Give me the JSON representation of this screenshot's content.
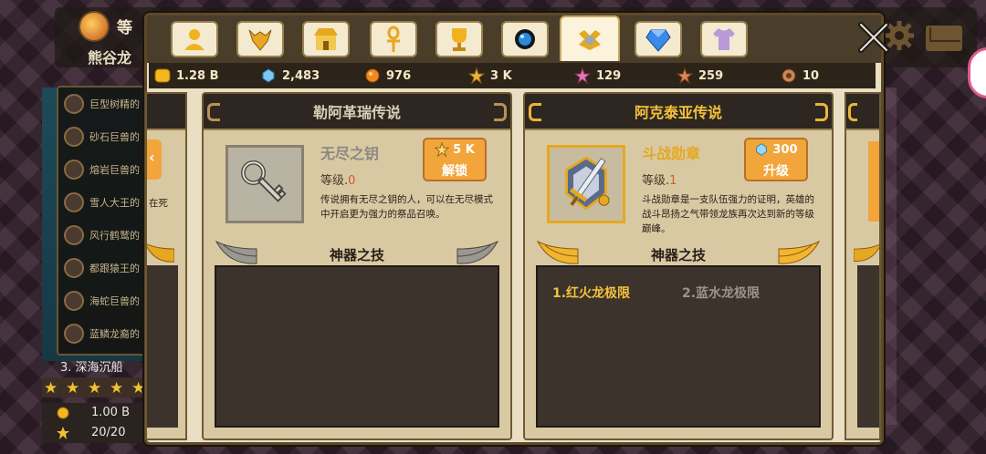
{
  "background": {
    "rank_label": "等",
    "player_name": "熊谷龙",
    "quests": [
      "巨型树精的",
      "砂石巨兽的",
      "熔岩巨兽的",
      "雪人大王的",
      "风行鹤鹫的",
      "都跟猿王的",
      "海蛇巨兽的",
      "蓝鳞龙裔的"
    ],
    "stage_label": "3. 深海沉船",
    "rewards": [
      {
        "icon": "gold-coin-icon",
        "value": "1.00 B"
      },
      {
        "icon": "star-icon",
        "value": "20/20"
      }
    ],
    "peek_left_text": "在死"
  },
  "tabs": [
    {
      "icon": "hero-icon",
      "active": false
    },
    {
      "icon": "dragon-head-icon",
      "active": false
    },
    {
      "icon": "shop-icon",
      "active": false
    },
    {
      "icon": "ankh-icon",
      "active": false
    },
    {
      "icon": "trophy-icon",
      "active": false
    },
    {
      "icon": "orb-icon",
      "active": false
    },
    {
      "icon": "artifact-icon",
      "active": true
    },
    {
      "icon": "gem-icon",
      "active": false
    },
    {
      "icon": "shirt-icon",
      "active": false
    }
  ],
  "currencies": [
    {
      "icon": "gold-coin-icon",
      "value": "1.28 B"
    },
    {
      "icon": "blue-crystal-icon",
      "value": "2,483"
    },
    {
      "icon": "orange-orb-icon",
      "value": "976"
    },
    {
      "icon": "gold-fragment-icon",
      "value": "3 K"
    },
    {
      "icon": "pink-fragment-icon",
      "value": "129"
    },
    {
      "icon": "scroll-fragment-icon",
      "value": "259"
    },
    {
      "icon": "bronze-medal-icon",
      "value": "10"
    }
  ],
  "panels": [
    {
      "title": "勒阿革瑞传说",
      "item_name": "无尽之钥",
      "item_icon": "key-icon",
      "level_label": "等级.",
      "level_value": "0",
      "description": "传说拥有无尽之钥的人，可以在无尽模式中开启更为强力的祭品召唤。",
      "button": {
        "cost_icon": "gold-fragment-icon",
        "cost": "5 K",
        "label": "解锁"
      },
      "skill_heading": "神器之技",
      "skills": []
    },
    {
      "title": "阿克泰亚传说",
      "item_name": "斗战勋章",
      "item_icon": "battle-medal-icon",
      "level_label": "等级.",
      "level_value": "1",
      "description": "斗战勋章是一支队伍强力的证明，英雄的战斗昂扬之气带领龙族再次达到新的等级巅峰。",
      "button": {
        "cost_icon": "blue-crystal-icon",
        "cost": "300",
        "label": "升级"
      },
      "skill_heading": "神器之技",
      "skills": [
        "1.红火龙极限",
        "2.蓝水龙极限"
      ]
    }
  ],
  "colors": {
    "gold_text": "#f3c13a",
    "muted_text": "#8a8a80",
    "level_value": "#d05a2a",
    "button_orange": "#f2a53a",
    "panel_bg": "#d9c9a3",
    "skill_box": "#3b332c"
  }
}
